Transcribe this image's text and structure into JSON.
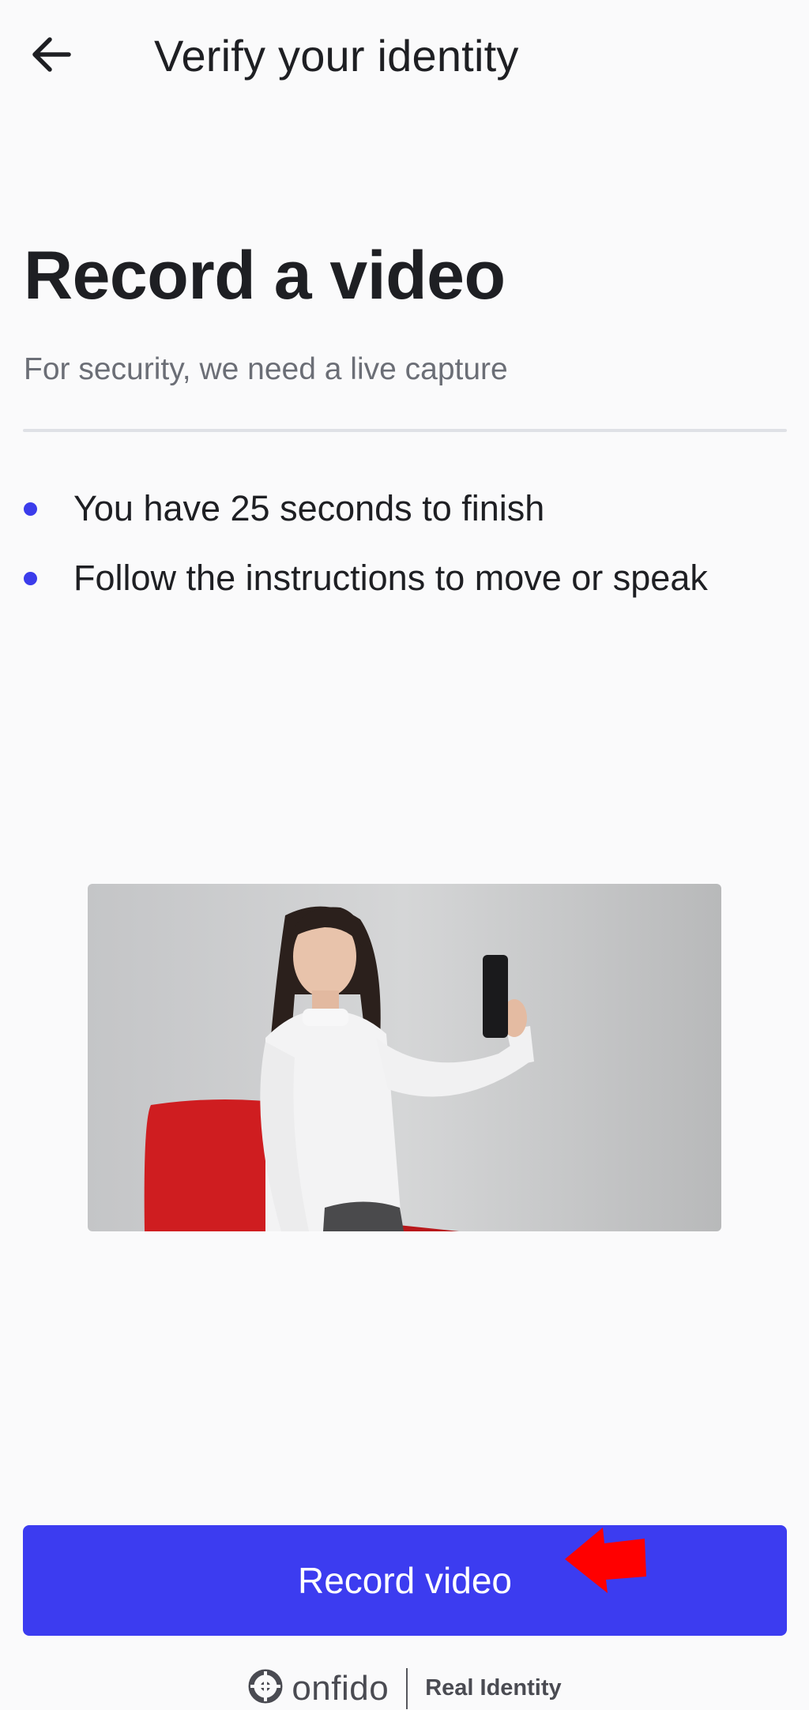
{
  "app_bar": {
    "back_icon": "arrow-left-icon",
    "title": "Verify your identity"
  },
  "main": {
    "heading": "Record a video",
    "subtitle": "For security, we need a live capture",
    "bullets": [
      {
        "text": "You have 25 seconds to finish"
      },
      {
        "text": "Follow the instructions to move or speak"
      }
    ],
    "illustration": "woman-recording-selfie-video-image"
  },
  "actions": {
    "record_label": "Record video",
    "button_color": "#3c3cf0",
    "annotation_arrow_color": "#ff0000"
  },
  "footer": {
    "brand": "onfido",
    "tagline": "Real Identity"
  },
  "colors": {
    "accent": "#3c3cf0",
    "bullet": "#3b3ceb",
    "background": "#fafafb"
  }
}
